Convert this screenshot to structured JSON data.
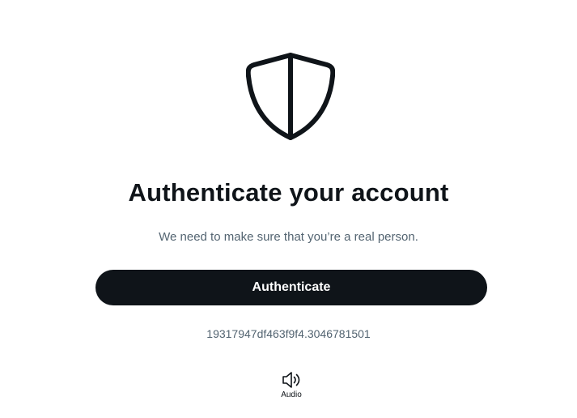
{
  "page": {
    "title": "Authenticate your account",
    "subtitle": "We need to make sure that you’re a real person.",
    "primary_button_label": "Authenticate",
    "session_id": "19317947df463f9f4.3046781501",
    "audio_label": "Audio"
  },
  "icons": {
    "hero": "shield-icon",
    "audio": "speaker-icon"
  },
  "colors": {
    "text_primary": "#0f1419",
    "text_secondary": "#536471",
    "button_bg": "#0f1419",
    "button_text": "#ffffff",
    "background": "#ffffff"
  }
}
